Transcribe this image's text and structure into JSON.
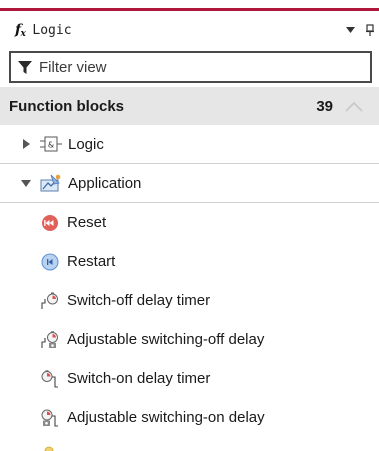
{
  "panel": {
    "icon": "fx-icon",
    "title": "Logic",
    "dropdown_glyph": "▼",
    "pin_glyph": "Ⅱ"
  },
  "filter": {
    "placeholder": "Filter view",
    "value": ""
  },
  "group": {
    "title": "Function blocks",
    "count": "39"
  },
  "categories": [
    {
      "label": "Logic",
      "icon": "logic-gate-icon",
      "expanded": false
    },
    {
      "label": "Application",
      "icon": "application-icon",
      "expanded": true
    }
  ],
  "items": [
    {
      "label": "Reset",
      "icon": "reset-icon"
    },
    {
      "label": "Restart",
      "icon": "restart-icon"
    },
    {
      "label": "Switch-off delay timer",
      "icon": "switch-off-delay-timer-icon"
    },
    {
      "label": "Adjustable switching-off delay",
      "icon": "adjustable-off-delay-icon"
    },
    {
      "label": "Switch-on delay timer",
      "icon": "switch-on-delay-timer-icon"
    },
    {
      "label": "Adjustable switching-on delay",
      "icon": "adjustable-on-delay-icon"
    }
  ],
  "colors": {
    "accent_bar": "#b0183b",
    "group_header_bg": "#e6e6e6",
    "reset_icon": "#e0605a",
    "restart_icon": "#5b8fd8"
  }
}
